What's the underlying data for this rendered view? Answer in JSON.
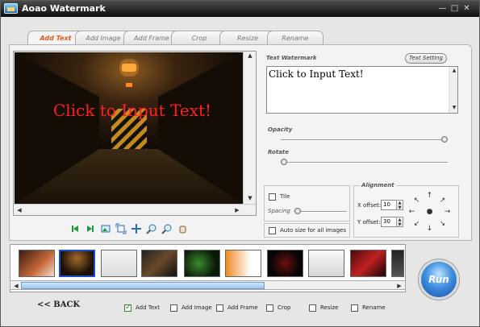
{
  "window": {
    "title": "Aoao Watermark",
    "min": "—",
    "max": "□",
    "close": "✕"
  },
  "tabs": [
    {
      "label": "Add Text",
      "active": true
    },
    {
      "label": "Add Image"
    },
    {
      "label": "Add Frame"
    },
    {
      "label": "Crop"
    },
    {
      "label": "Resize"
    },
    {
      "label": "Rename"
    }
  ],
  "preview": {
    "watermark_text": "Click to Input Text!"
  },
  "text_panel": {
    "section_label": "Text Watermark",
    "setting_button": "Text Setting",
    "input_value": "Click to Input Text!",
    "opacity_label": "Opacity",
    "opacity_value": 1.0,
    "rotate_label": "Rotate",
    "rotate_value": 0.0
  },
  "tile": {
    "label": "Tile",
    "checked": false,
    "spacing_label": "Spacing"
  },
  "auto_size": {
    "label": "Auto size for all images",
    "checked": false
  },
  "alignment": {
    "label": "Alignment",
    "x_label": "X offset:",
    "x_value": "10",
    "y_label": "Y offset:",
    "y_value": "30"
  },
  "bottom": {
    "back_label": "<< BACK",
    "run_label": "Run",
    "checks": [
      {
        "label": "Add Text",
        "checked": true
      },
      {
        "label": "Add Image",
        "checked": false
      },
      {
        "label": "Add Frame",
        "checked": false
      },
      {
        "label": "Crop",
        "checked": false
      },
      {
        "label": "Resize",
        "checked": false
      },
      {
        "label": "Rename",
        "checked": false
      }
    ]
  },
  "colors": {
    "accent_tab": "#e0591c",
    "watermark_red": "#ff2020",
    "check_green": "#2a9d2a"
  }
}
